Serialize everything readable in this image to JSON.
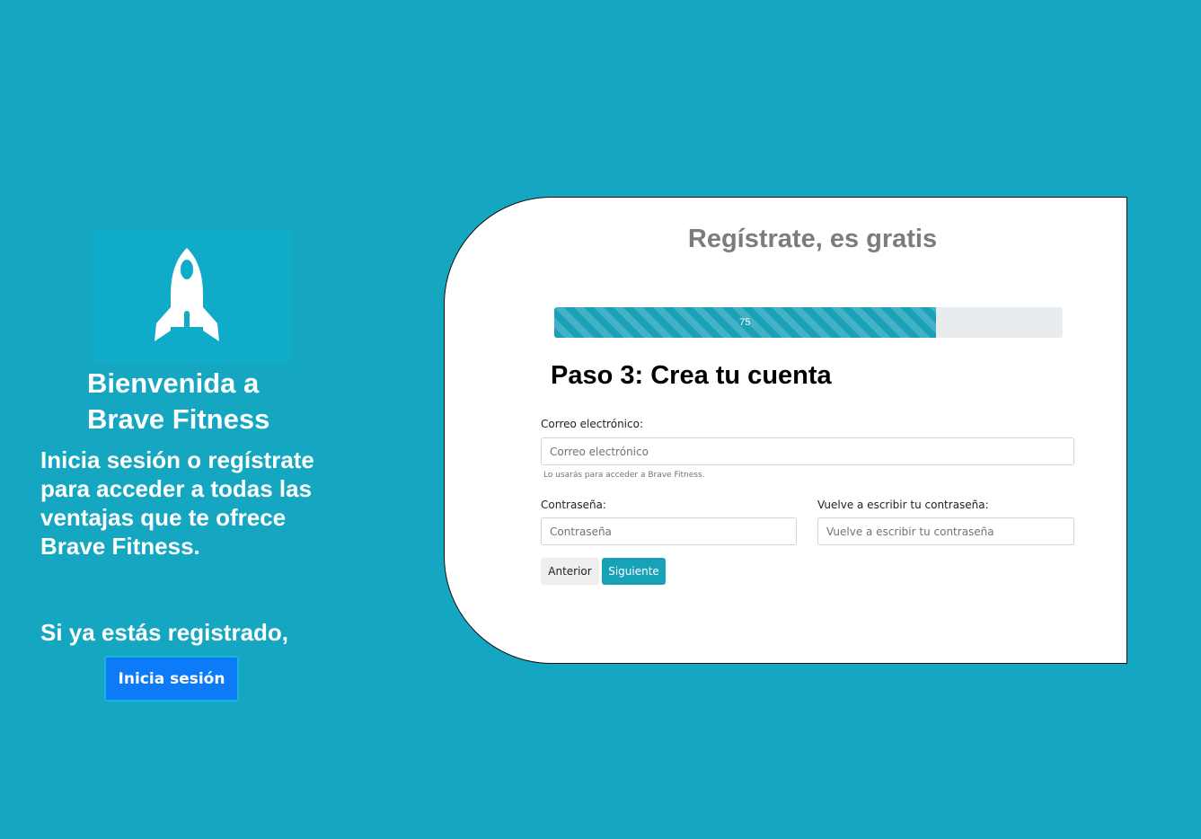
{
  "left_panel": {
    "logo_icon": "rocket-icon",
    "welcome_line1": "Bienvenida a",
    "welcome_line2": "Brave Fitness",
    "intro": "Inicia sesión o regístrate para acceder a todas las ventajas que te ofrece Brave Fitness.",
    "already_registered": "Si ya estás registrado,",
    "login_button": "Inicia sesión"
  },
  "card": {
    "title": "Regístrate, es gratis",
    "progress": {
      "percent": 75,
      "label": "75"
    },
    "step_title": "Paso 3: Crea tu cuenta",
    "email": {
      "label": "Correo electrónico:",
      "placeholder": "Correo electrónico",
      "help": "Lo usarás para acceder a Brave Fitness."
    },
    "password": {
      "label": "Contraseña:",
      "placeholder": "Contraseña"
    },
    "confirm_password": {
      "label": "Vuelve a escribir tu contraseña:",
      "placeholder": "Vuelve a escribir tu contraseña"
    },
    "prev_button": "Anterior",
    "next_button": "Siguiente"
  },
  "colors": {
    "background": "#15a6c1",
    "progress": "#1aa1b8",
    "primary_button": "#0d7af7",
    "info_button": "#17a2b8"
  }
}
